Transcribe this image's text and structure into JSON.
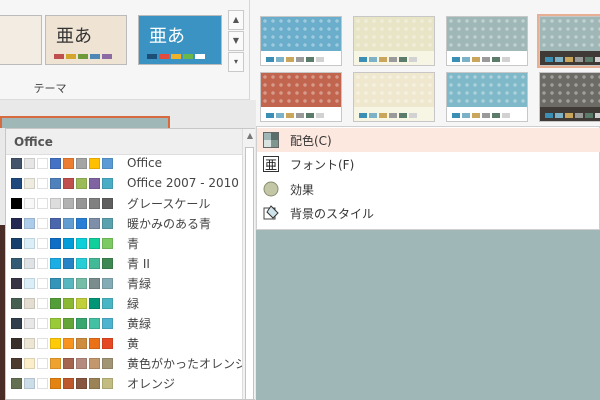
{
  "ribbon": {
    "group_label": "テーマ",
    "themes": [
      {
        "name": "theme-thumb-1",
        "text": "",
        "bg": "#f2ece3",
        "accent": "#c8a989"
      },
      {
        "name": "theme-thumb-2",
        "text": "亜あ",
        "bg": "#efe3d3",
        "accent": "#333333"
      },
      {
        "name": "theme-thumb-3",
        "text": "亜あ",
        "bg": "#3a93c2",
        "accent": "#ffffff"
      }
    ],
    "scroll": {
      "up": "▲",
      "down": "▼",
      "more": "▾"
    }
  },
  "variants": [
    {
      "pattern": "#6aaecb",
      "bar": "#ffffff"
    },
    {
      "pattern": "#e8e5c7",
      "bar": "#f7f5e3"
    },
    {
      "pattern": "#9fb7b7",
      "bar": "#ffffff"
    },
    {
      "pattern": "#9fb7b7",
      "bar": "#3f3a35"
    },
    {
      "pattern": "#c1654f",
      "bar": "#ffffff"
    },
    {
      "pattern": "#efe8cf",
      "bar": "#f7f5e3"
    },
    {
      "pattern": "#7fb8c8",
      "bar": "#ffffff"
    },
    {
      "pattern": "#6c6b66",
      "bar": "#3f3a35"
    }
  ],
  "menu": {
    "items": [
      {
        "label": "配色(C)",
        "icon": "color-scheme-icon",
        "active": true
      },
      {
        "label": "フォント(F)",
        "icon": "font-icon",
        "active": false
      },
      {
        "label": "効果",
        "icon": "effects-icon",
        "active": false
      },
      {
        "label": "背景のスタイル",
        "icon": "background-style-icon",
        "active": false
      }
    ]
  },
  "schemes": {
    "header": "Office",
    "rows": [
      {
        "name": "Office",
        "colors": [
          "#44546a",
          "#e7e6e6",
          "#ffffff",
          "#4472c4",
          "#ed7d31",
          "#a5a5a5",
          "#ffc000",
          "#5b9bd5"
        ]
      },
      {
        "name": "Office 2007 - 2010",
        "colors": [
          "#1f497d",
          "#eeece1",
          "#ffffff",
          "#4f81bd",
          "#c0504d",
          "#9bbb59",
          "#8064a2",
          "#4bacc6"
        ]
      },
      {
        "name": "グレースケール",
        "colors": [
          "#000000",
          "#f8f8f8",
          "#ffffff",
          "#dddddd",
          "#b2b2b2",
          "#969696",
          "#808080",
          "#5f5f5f"
        ]
      },
      {
        "name": "暖かみのある青",
        "colors": [
          "#242852",
          "#acccea",
          "#ffffff",
          "#4a66ac",
          "#629dd1",
          "#297fd5",
          "#7f8fa9",
          "#5aa2ae"
        ]
      },
      {
        "name": "青",
        "colors": [
          "#17406d",
          "#dbeff9",
          "#ffffff",
          "#0f6fc6",
          "#009dd9",
          "#0bd0d9",
          "#10cf9b",
          "#7cca62"
        ]
      },
      {
        "name": "青 II",
        "colors": [
          "#335b74",
          "#dfe3e5",
          "#ffffff",
          "#1cade4",
          "#2683c6",
          "#27ced7",
          "#42ba97",
          "#3e8853"
        ]
      },
      {
        "name": "青緑",
        "colors": [
          "#373545",
          "#dbeff9",
          "#ffffff",
          "#3494ba",
          "#58b6c0",
          "#75bda7",
          "#7a8c8e",
          "#84acb6"
        ]
      },
      {
        "name": "緑",
        "colors": [
          "#455f51",
          "#e3ded1",
          "#ffffff",
          "#549e39",
          "#8ab833",
          "#c0cf3a",
          "#029676",
          "#4ab5c4"
        ]
      },
      {
        "name": "黄緑",
        "colors": [
          "#2f3e4a",
          "#e8e8e8",
          "#ffffff",
          "#99cb38",
          "#63a537",
          "#37a76f",
          "#44c1a3",
          "#4eb3cf"
        ]
      },
      {
        "name": "黄",
        "colors": [
          "#39302a",
          "#ede6d4",
          "#ffffff",
          "#ffca08",
          "#f8931d",
          "#ce8d3e",
          "#ec7016",
          "#e64823"
        ]
      },
      {
        "name": "黄色がかったオレンジ",
        "colors": [
          "#4e3b30",
          "#fbeec9",
          "#ffffff",
          "#f0a22e",
          "#a5644e",
          "#b58b80",
          "#c3986d",
          "#a19574"
        ]
      },
      {
        "name": "オレンジ",
        "colors": [
          "#637052",
          "#ccddea",
          "#ffffff",
          "#e48312",
          "#bd582c",
          "#865640",
          "#9b8357",
          "#c2bc80"
        ]
      }
    ]
  },
  "slide": {
    "bg": "#9fb7b7",
    "selected_border": "#d86a3f"
  }
}
